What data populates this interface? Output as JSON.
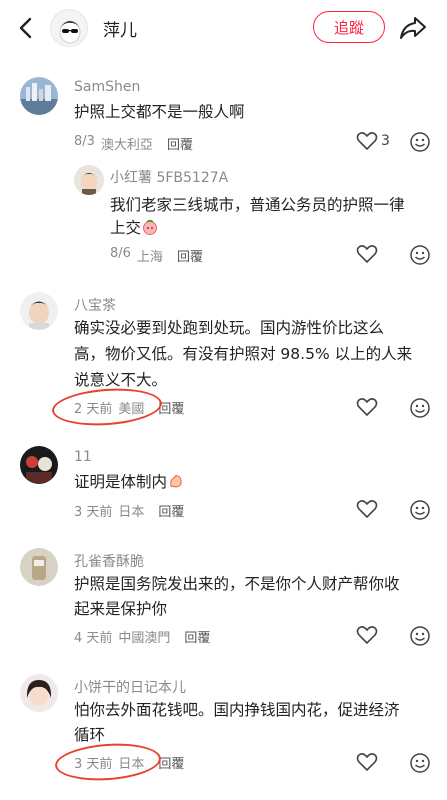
{
  "header": {
    "title": "萍儿",
    "follow_label": "追蹤"
  },
  "comments": [
    {
      "name": "SamShen",
      "text": "护照上交都不是一般人啊",
      "date": "8/3",
      "location": "澳大利亞",
      "reply_label": "回覆",
      "likes": "3"
    },
    {
      "name": "小红薯 5FB5127A",
      "text_line1": "我们老家三线城市，普通公务员的护照一律",
      "text_line2": "上交",
      "date": "8/6",
      "location": "上海",
      "reply_label": "回覆"
    },
    {
      "name": "八宝茶",
      "text_line1": "确实没必要到处跑到处玩。国内游性价比这么",
      "text_line2": "高，物价又低。有没有护照对 98.5% 以上的人来",
      "text_line3": "说意义不大。",
      "date": "2 天前",
      "location": "美國",
      "reply_label": "回覆"
    },
    {
      "name": "11",
      "text": "证明是体制内",
      "date": "3 天前",
      "location": "日本",
      "reply_label": "回覆"
    },
    {
      "name": "孔雀香酥脆",
      "text_line1": "护照是国务院发出来的，不是你个人财产帮你收",
      "text_line2": "起来是保护你",
      "date": "4 天前",
      "location": "中國澳門",
      "reply_label": "回覆"
    },
    {
      "name": "小饼干的日记本儿",
      "text_line1": "怕你去外面花钱吧。国内挣钱国内花，促进经济",
      "text_line2": "循环",
      "date": "3 天前",
      "location": "日本",
      "reply_label": "回覆"
    }
  ],
  "colors": {
    "accent": "#ff2442",
    "annotation": "#e8422b",
    "meta": "#8a8a8a"
  }
}
